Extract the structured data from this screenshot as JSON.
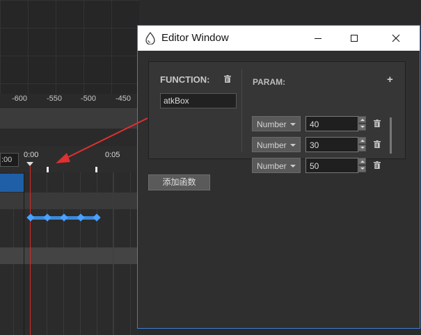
{
  "timeline": {
    "ruler_labels": [
      "-600",
      "-550",
      "-500",
      "-450"
    ],
    "time_field": ":00",
    "tick_start": "0:00",
    "tick_mid": "0:05"
  },
  "window": {
    "title": "Editor Window"
  },
  "editor": {
    "function_label": "FUNCTION:",
    "function_value": "atkBox",
    "param_label": "PARAM:",
    "add_param_icon": "+",
    "params": [
      {
        "type": "Number",
        "value": "40"
      },
      {
        "type": "Number",
        "value": "30"
      },
      {
        "type": "Number",
        "value": "50"
      }
    ],
    "add_function_label": "添加函数"
  },
  "colors": {
    "accent": "#3b7dd8",
    "playhead": "#d42a2a",
    "keyframe": "#4aa0ff",
    "selected_track": "#1f5fa8"
  }
}
